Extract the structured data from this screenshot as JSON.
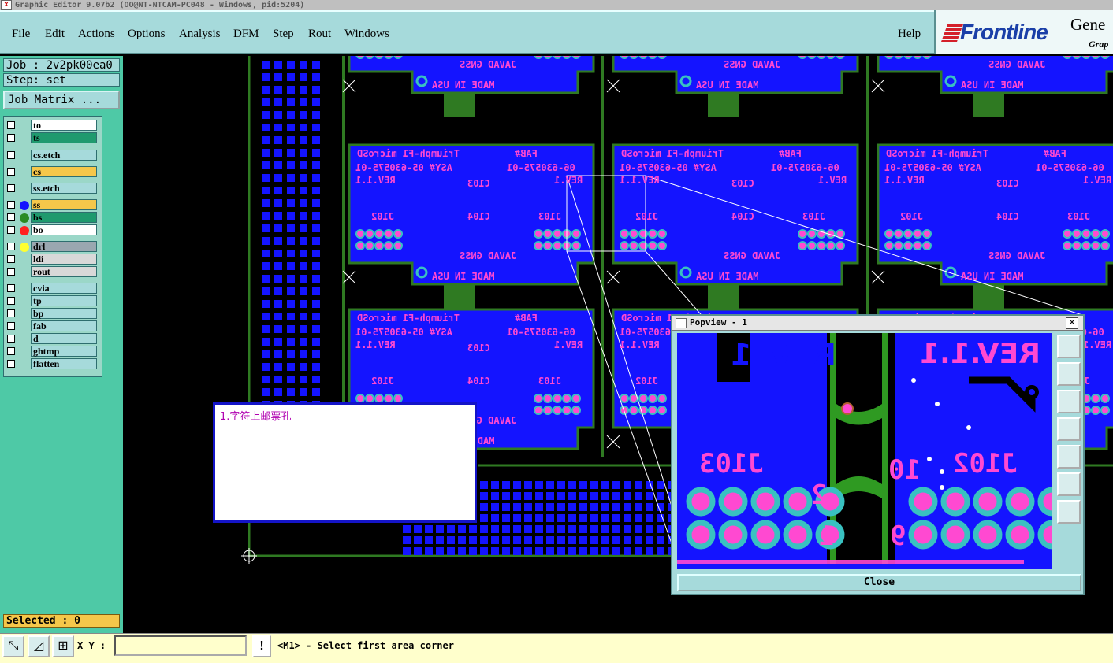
{
  "window": {
    "title": "Graphic Editor 9.07b2 (OO@NT-NTCAM-PC048 - Windows, pid:5204)"
  },
  "menubar": {
    "items": [
      "File",
      "Edit",
      "Actions",
      "Options",
      "Analysis",
      "DFM",
      "Step",
      "Rout",
      "Windows"
    ],
    "help": "Help"
  },
  "logo": {
    "brand": "Frontline",
    "product_partial": "Gene",
    "subtitle_partial": "Grap"
  },
  "left_panel": {
    "job": "Job : 2v2pk00ea0",
    "step": "Step: set",
    "job_matrix_button": "Job Matrix ...",
    "layers": [
      {
        "name": "to",
        "color": "#ffffff",
        "dot": ""
      },
      {
        "name": "ts",
        "color": "#1f9a6e",
        "dot": ""
      },
      {
        "name": "cs.etch",
        "color": "#a6dadb",
        "dot": ""
      },
      {
        "name": "cs",
        "color": "#f5c74a",
        "dot": ""
      },
      {
        "name": "ss.etch",
        "color": "#a6dadb",
        "dot": ""
      },
      {
        "name": "ss",
        "color": "#f5c74a",
        "dot": "#1414ff"
      },
      {
        "name": "bs",
        "color": "#1f9a6e",
        "dot": "#2a8a22"
      },
      {
        "name": "bo",
        "color": "#ffffff",
        "dot": "#ff2020"
      },
      {
        "name": "drl",
        "color": "#9aa7b0",
        "dot": "#ffff30"
      },
      {
        "name": "ldi",
        "color": "#d8d8d8",
        "dot": ""
      },
      {
        "name": "rout",
        "color": "#d8d8d8",
        "dot": ""
      },
      {
        "name": "cvia",
        "color": "#a6dadb",
        "dot": ""
      },
      {
        "name": "tp",
        "color": "#a6dadb",
        "dot": ""
      },
      {
        "name": "bp",
        "color": "#a6dadb",
        "dot": ""
      },
      {
        "name": "fab",
        "color": "#a6dadb",
        "dot": ""
      },
      {
        "name": "d",
        "color": "#a6dadb",
        "dot": ""
      },
      {
        "name": "ghtmp",
        "color": "#a6dadb",
        "dot": ""
      },
      {
        "name": "flatten",
        "color": "#a6dadb",
        "dot": ""
      }
    ],
    "selected": "Selected : 0"
  },
  "canvas": {
    "board_texts": {
      "title": "Triumph-F1 microSD",
      "asy": "ASY# 05-630575-01",
      "part": "06-630575-01",
      "rev": "REV.1",
      "rev_small": "REV.1.1",
      "fab": "FAB#",
      "brand": "JAVAD GNSS",
      "made": "MADE IN USA",
      "c103": "C103",
      "c104": "C104",
      "j103": "J103",
      "j102": "J102"
    },
    "note_text": "1.字符上邮票孔"
  },
  "popview": {
    "title": "Popview - 1",
    "close_button": "Close",
    "texts": [
      "REV. 1",
      "REV.1.1",
      "J103",
      "J102",
      "10",
      "2",
      "1",
      "9"
    ]
  },
  "bottom_bar": {
    "xy_label": "X Y :",
    "xy_value": "",
    "status": "<M1> - Select first area corner"
  }
}
